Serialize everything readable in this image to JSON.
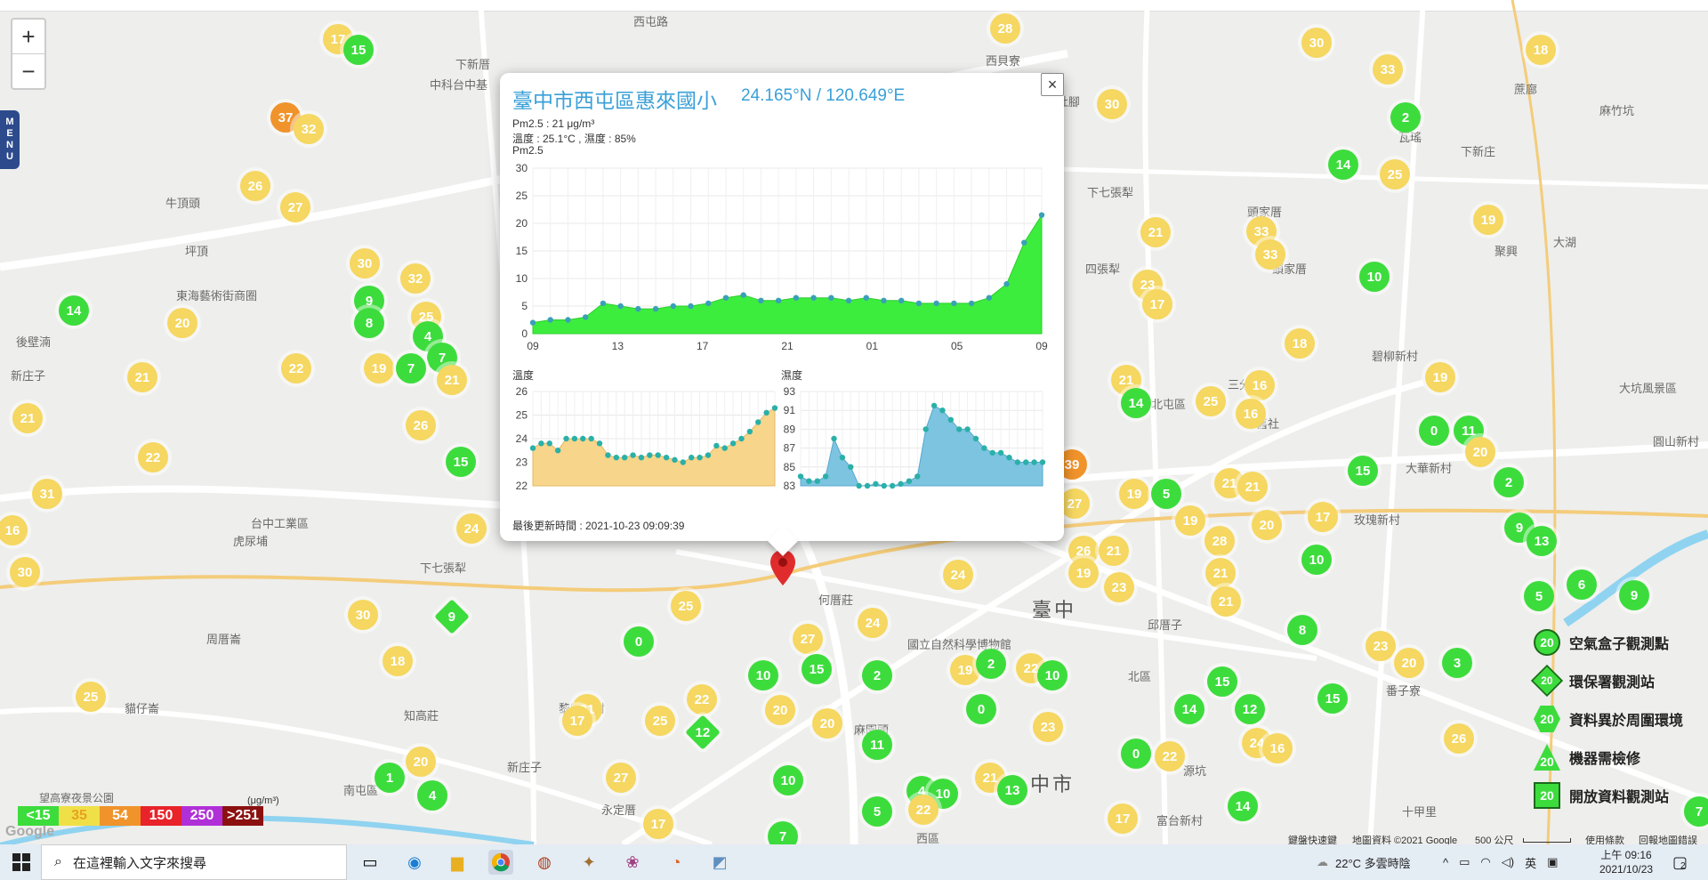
{
  "map": {
    "menu_label": [
      "M",
      "E",
      "N",
      "U"
    ],
    "zoom_in": "+",
    "zoom_out": "−",
    "places": [
      {
        "t": "下新厝",
        "x": 512,
        "y": 62
      },
      {
        "t": "中科台中基",
        "x": 483,
        "y": 85
      },
      {
        "t": "西屯路",
        "x": 712,
        "y": 14
      },
      {
        "t": "牛頂頭",
        "x": 186,
        "y": 218
      },
      {
        "t": "坪頂",
        "x": 208,
        "y": 272
      },
      {
        "t": "東海藝術街商圈",
        "x": 198,
        "y": 322
      },
      {
        "t": "後壁湳",
        "x": 18,
        "y": 374
      },
      {
        "t": "新庄子",
        "x": 12,
        "y": 412
      },
      {
        "t": "台中工業區",
        "x": 282,
        "y": 578
      },
      {
        "t": "虎尿埔",
        "x": 262,
        "y": 598
      },
      {
        "t": "下七張犁",
        "x": 472,
        "y": 628
      },
      {
        "t": "周厝崙",
        "x": 232,
        "y": 708
      },
      {
        "t": "貓仔崙",
        "x": 140,
        "y": 786
      },
      {
        "t": "知高莊",
        "x": 454,
        "y": 794
      },
      {
        "t": "南屯區",
        "x": 386,
        "y": 878
      },
      {
        "t": "黎明新村",
        "x": 628,
        "y": 786
      },
      {
        "t": "新庄子",
        "x": 570,
        "y": 852
      },
      {
        "t": "永定厝",
        "x": 676,
        "y": 900
      },
      {
        "t": "何厝莊",
        "x": 920,
        "y": 664
      },
      {
        "t": "國立自然科學博物館",
        "x": 1020,
        "y": 714
      },
      {
        "t": "麻園頭",
        "x": 960,
        "y": 810
      },
      {
        "t": "西區",
        "x": 1030,
        "y": 932
      },
      {
        "t": "邱厝子",
        "x": 1290,
        "y": 692
      },
      {
        "t": "北區",
        "x": 1268,
        "y": 750
      },
      {
        "t": "三分埔",
        "x": 1380,
        "y": 422
      },
      {
        "t": "北屯區",
        "x": 1294,
        "y": 444
      },
      {
        "t": "四張犁",
        "x": 1220,
        "y": 292
      },
      {
        "t": "頭家厝",
        "x": 1402,
        "y": 228
      },
      {
        "t": "頭家厝",
        "x": 1430,
        "y": 292
      },
      {
        "t": "下七張犁",
        "x": 1222,
        "y": 206
      },
      {
        "t": "社腳",
        "x": 1188,
        "y": 104
      },
      {
        "t": "西貝寮",
        "x": 1108,
        "y": 58
      },
      {
        "t": "瓦瑤",
        "x": 1572,
        "y": 144
      },
      {
        "t": "下新庄",
        "x": 1642,
        "y": 160
      },
      {
        "t": "大坑風景區",
        "x": 1820,
        "y": 426
      },
      {
        "t": "大華新村",
        "x": 1580,
        "y": 516
      },
      {
        "t": "玫瑰新村",
        "x": 1522,
        "y": 574
      },
      {
        "t": "大湖",
        "x": 1746,
        "y": 262
      },
      {
        "t": "聚興",
        "x": 1680,
        "y": 272
      },
      {
        "t": "麻竹坑",
        "x": 1798,
        "y": 114
      },
      {
        "t": "蔗廍",
        "x": 1702,
        "y": 90
      },
      {
        "t": "圓山新村",
        "x": 1858,
        "y": 486
      },
      {
        "t": "番子寮",
        "x": 1558,
        "y": 766
      },
      {
        "t": "十甲里",
        "x": 1576,
        "y": 902
      },
      {
        "t": "源坑",
        "x": 1330,
        "y": 856
      },
      {
        "t": "富台新村",
        "x": 1300,
        "y": 912
      },
      {
        "t": "碧柳新村",
        "x": 1542,
        "y": 390
      },
      {
        "t": "舊社",
        "x": 1412,
        "y": 466
      }
    ],
    "big_places": [
      {
        "t": "臺中",
        "x": 1160,
        "y": 668
      },
      {
        "t": "中市",
        "x": 1158,
        "y": 864
      }
    ],
    "markers": [
      {
        "v": "17",
        "c": "y",
        "x": 380,
        "y": 44
      },
      {
        "v": "15",
        "c": "g",
        "x": 403,
        "y": 56
      },
      {
        "v": "28",
        "c": "y",
        "x": 1130,
        "y": 32
      },
      {
        "v": "30",
        "c": "y",
        "x": 1480,
        "y": 48
      },
      {
        "v": "18",
        "c": "y",
        "x": 1732,
        "y": 56
      },
      {
        "v": "33",
        "c": "y",
        "x": 1560,
        "y": 78
      },
      {
        "v": "30",
        "c": "y",
        "x": 1250,
        "y": 117
      },
      {
        "v": "2",
        "c": "g",
        "x": 1580,
        "y": 132
      },
      {
        "v": "37",
        "c": "o",
        "x": 321,
        "y": 132
      },
      {
        "v": "32",
        "c": "y",
        "x": 347,
        "y": 145
      },
      {
        "v": "14",
        "c": "g",
        "x": 1510,
        "y": 185
      },
      {
        "v": "25",
        "c": "y",
        "x": 1568,
        "y": 196
      },
      {
        "v": "26",
        "c": "y",
        "x": 287,
        "y": 209
      },
      {
        "v": "27",
        "c": "y",
        "x": 332,
        "y": 233
      },
      {
        "v": "19",
        "c": "y",
        "x": 1673,
        "y": 247
      },
      {
        "v": "33",
        "c": "y",
        "x": 1418,
        "y": 260
      },
      {
        "v": "21",
        "c": "y",
        "x": 1299,
        "y": 261
      },
      {
        "v": "33",
        "c": "y",
        "x": 1428,
        "y": 286
      },
      {
        "v": "30",
        "c": "y",
        "x": 410,
        "y": 296
      },
      {
        "v": "32",
        "c": "y",
        "x": 467,
        "y": 313
      },
      {
        "v": "10",
        "c": "g",
        "x": 1545,
        "y": 311
      },
      {
        "v": "9",
        "c": "g",
        "x": 415,
        "y": 338
      },
      {
        "v": "23",
        "c": "y",
        "x": 1290,
        "y": 320
      },
      {
        "v": "17",
        "c": "y",
        "x": 1301,
        "y": 342
      },
      {
        "v": "14",
        "c": "g",
        "x": 83,
        "y": 349
      },
      {
        "v": "20",
        "c": "y",
        "x": 205,
        "y": 363
      },
      {
        "v": "8",
        "c": "g",
        "x": 415,
        "y": 363
      },
      {
        "v": "25",
        "c": "y",
        "x": 479,
        "y": 356
      },
      {
        "v": "4",
        "c": "g",
        "x": 481,
        "y": 378
      },
      {
        "v": "18",
        "c": "y",
        "x": 1461,
        "y": 386
      },
      {
        "v": "7",
        "c": "g",
        "x": 497,
        "y": 402
      },
      {
        "v": "22",
        "c": "y",
        "x": 333,
        "y": 414
      },
      {
        "v": "19",
        "c": "y",
        "x": 426,
        "y": 414
      },
      {
        "v": "7",
        "c": "g",
        "x": 462,
        "y": 414
      },
      {
        "v": "19",
        "c": "y",
        "x": 1619,
        "y": 424
      },
      {
        "v": "21",
        "c": "y",
        "x": 160,
        "y": 424
      },
      {
        "v": "21",
        "c": "y",
        "x": 508,
        "y": 427
      },
      {
        "v": "21",
        "c": "y",
        "x": 1266,
        "y": 427
      },
      {
        "v": "16",
        "c": "y",
        "x": 1416,
        "y": 433
      },
      {
        "v": "14",
        "c": "g",
        "x": 1277,
        "y": 453
      },
      {
        "v": "25",
        "c": "y",
        "x": 1361,
        "y": 451
      },
      {
        "v": "16",
        "c": "y",
        "x": 1406,
        "y": 465
      },
      {
        "v": "21",
        "c": "y",
        "x": 31,
        "y": 470
      },
      {
        "v": "26",
        "c": "y",
        "x": 473,
        "y": 478
      },
      {
        "v": "0",
        "c": "g",
        "x": 1612,
        "y": 484
      },
      {
        "v": "11",
        "c": "g",
        "x": 1651,
        "y": 484
      },
      {
        "v": "20",
        "c": "y",
        "x": 1664,
        "y": 508
      },
      {
        "v": "22",
        "c": "y",
        "x": 172,
        "y": 514
      },
      {
        "v": "15",
        "c": "g",
        "x": 518,
        "y": 519
      },
      {
        "v": "15",
        "c": "g",
        "x": 1532,
        "y": 529
      },
      {
        "v": "21",
        "c": "y",
        "x": 1382,
        "y": 543
      },
      {
        "v": "21",
        "c": "y",
        "x": 1408,
        "y": 547
      },
      {
        "v": "2",
        "c": "g",
        "x": 1696,
        "y": 542
      },
      {
        "v": "31",
        "c": "y",
        "x": 53,
        "y": 555
      },
      {
        "v": "19",
        "c": "y",
        "x": 1275,
        "y": 555
      },
      {
        "v": "5",
        "c": "g",
        "x": 1311,
        "y": 555
      },
      {
        "v": "27",
        "c": "y",
        "x": 1208,
        "y": 566
      },
      {
        "v": "17",
        "c": "y",
        "x": 1487,
        "y": 581
      },
      {
        "v": "19",
        "c": "y",
        "x": 1338,
        "y": 585
      },
      {
        "v": "20",
        "c": "y",
        "x": 1424,
        "y": 590
      },
      {
        "v": "9",
        "c": "g",
        "x": 1708,
        "y": 593
      },
      {
        "v": "16",
        "c": "y",
        "x": 14,
        "y": 596
      },
      {
        "v": "24",
        "c": "y",
        "x": 530,
        "y": 594
      },
      {
        "v": "28",
        "c": "y",
        "x": 1371,
        "y": 608
      },
      {
        "v": "13",
        "c": "g",
        "x": 1733,
        "y": 608
      },
      {
        "v": "26",
        "c": "y",
        "x": 1218,
        "y": 619
      },
      {
        "v": "21",
        "c": "y",
        "x": 1252,
        "y": 619
      },
      {
        "v": "10",
        "c": "g",
        "x": 1480,
        "y": 629
      },
      {
        "v": "30",
        "c": "y",
        "x": 28,
        "y": 643
      },
      {
        "v": "21",
        "c": "y",
        "x": 1372,
        "y": 644
      },
      {
        "v": "24",
        "c": "y",
        "x": 1077,
        "y": 646
      },
      {
        "v": "19",
        "c": "y",
        "x": 1218,
        "y": 644
      },
      {
        "v": "23",
        "c": "y",
        "x": 1258,
        "y": 660
      },
      {
        "v": "6",
        "c": "g",
        "x": 1778,
        "y": 657
      },
      {
        "v": "21",
        "c": "y",
        "x": 1378,
        "y": 676
      },
      {
        "v": "5",
        "c": "g",
        "x": 1730,
        "y": 670
      },
      {
        "v": "9",
        "c": "g",
        "x": 1837,
        "y": 669
      },
      {
        "v": "25",
        "c": "y",
        "x": 771,
        "y": 681
      },
      {
        "v": "30",
        "c": "y",
        "x": 408,
        "y": 691
      },
      {
        "v": "8",
        "c": "g",
        "x": 1464,
        "y": 708
      },
      {
        "v": "0",
        "c": "g",
        "x": 718,
        "y": 721
      },
      {
        "v": "24",
        "c": "y",
        "x": 981,
        "y": 700
      },
      {
        "v": "27",
        "c": "y",
        "x": 908,
        "y": 718
      },
      {
        "v": "23",
        "c": "y",
        "x": 1552,
        "y": 726
      },
      {
        "v": "20",
        "c": "y",
        "x": 1584,
        "y": 745
      },
      {
        "v": "3",
        "c": "g",
        "x": 1638,
        "y": 745
      },
      {
        "v": "18",
        "c": "y",
        "x": 447,
        "y": 743
      },
      {
        "v": "10",
        "c": "g",
        "x": 858,
        "y": 759
      },
      {
        "v": "15",
        "c": "g",
        "x": 918,
        "y": 752
      },
      {
        "v": "2",
        "c": "g",
        "x": 986,
        "y": 759
      },
      {
        "v": "19",
        "c": "y",
        "x": 1085,
        "y": 753
      },
      {
        "v": "2",
        "c": "g",
        "x": 1114,
        "y": 746
      },
      {
        "v": "22",
        "c": "y",
        "x": 1159,
        "y": 751
      },
      {
        "v": "10",
        "c": "g",
        "x": 1183,
        "y": 759
      },
      {
        "v": "15",
        "c": "g",
        "x": 1374,
        "y": 766
      },
      {
        "v": "25",
        "c": "y",
        "x": 102,
        "y": 783
      },
      {
        "v": "22",
        "c": "y",
        "x": 789,
        "y": 786
      },
      {
        "v": "15",
        "c": "g",
        "x": 1498,
        "y": 785
      },
      {
        "v": "20",
        "c": "y",
        "x": 877,
        "y": 798
      },
      {
        "v": "0",
        "c": "g",
        "x": 1103,
        "y": 797
      },
      {
        "v": "14",
        "c": "g",
        "x": 1337,
        "y": 797
      },
      {
        "v": "12",
        "c": "g",
        "x": 1405,
        "y": 797
      },
      {
        "v": "31",
        "c": "y",
        "x": 660,
        "y": 797
      },
      {
        "v": "17",
        "c": "y",
        "x": 649,
        "y": 810
      },
      {
        "v": "25",
        "c": "y",
        "x": 742,
        "y": 810
      },
      {
        "v": "20",
        "c": "y",
        "x": 930,
        "y": 813
      },
      {
        "v": "23",
        "c": "y",
        "x": 1178,
        "y": 817
      },
      {
        "v": "26",
        "c": "y",
        "x": 1640,
        "y": 830
      },
      {
        "v": "24",
        "c": "y",
        "x": 1413,
        "y": 835
      },
      {
        "v": "16",
        "c": "y",
        "x": 1436,
        "y": 841
      },
      {
        "v": "11",
        "c": "g",
        "x": 986,
        "y": 837
      },
      {
        "v": "0",
        "c": "g",
        "x": 1277,
        "y": 847
      },
      {
        "v": "22",
        "c": "y",
        "x": 1315,
        "y": 850
      },
      {
        "v": "20",
        "c": "y",
        "x": 473,
        "y": 856
      },
      {
        "v": "1",
        "c": "g",
        "x": 438,
        "y": 874
      },
      {
        "v": "27",
        "c": "y",
        "x": 698,
        "y": 874
      },
      {
        "v": "10",
        "c": "g",
        "x": 886,
        "y": 877
      },
      {
        "v": "21",
        "c": "y",
        "x": 1113,
        "y": 874
      },
      {
        "v": "4",
        "c": "g",
        "x": 1036,
        "y": 889
      },
      {
        "v": "10",
        "c": "g",
        "x": 1060,
        "y": 892
      },
      {
        "v": "13",
        "c": "g",
        "x": 1138,
        "y": 888
      },
      {
        "v": "4",
        "c": "g",
        "x": 486,
        "y": 894
      },
      {
        "v": "22",
        "c": "y",
        "x": 1038,
        "y": 910
      },
      {
        "v": "14",
        "c": "g",
        "x": 1397,
        "y": 906
      },
      {
        "v": "5",
        "c": "g",
        "x": 986,
        "y": 912
      },
      {
        "v": "17",
        "c": "y",
        "x": 1262,
        "y": 920
      },
      {
        "v": "17",
        "c": "y",
        "x": 740,
        "y": 926
      },
      {
        "v": "7",
        "c": "g",
        "x": 1910,
        "y": 912
      },
      {
        "v": "7",
        "c": "g",
        "x": 880,
        "y": 940
      }
    ],
    "diamonds": [
      {
        "v": "9",
        "c": "g",
        "x": 508,
        "y": 693
      },
      {
        "v": "12",
        "c": "g",
        "x": 790,
        "y": 823
      }
    ],
    "orange_right": {
      "v": "39",
      "x": 1205,
      "y": 522
    },
    "legend": [
      {
        "icon": "circle",
        "v": "20",
        "label": "空氣盒子觀測點"
      },
      {
        "icon": "diamond",
        "v": "20",
        "label": "環保署觀測站"
      },
      {
        "icon": "hexagon",
        "v": "20",
        "label": "資料異於周圍環境"
      },
      {
        "icon": "triangle",
        "v": "20",
        "label": "機器需檢修"
      },
      {
        "icon": "square",
        "v": "20",
        "label": "開放資料觀測站"
      }
    ],
    "pm_scale": [
      {
        "label": "<15",
        "color": "#3ddc3d"
      },
      {
        "label": "35",
        "color": "#f0e048"
      },
      {
        "label": "54",
        "color": "#f0932b"
      },
      {
        "label": "150",
        "color": "#e8232a"
      },
      {
        "label": "250",
        "color": "#b030d8"
      },
      {
        "label": ">251",
        "color": "#8b1010"
      }
    ],
    "pm_unit": "(μg/m³)",
    "bottom_place": "望高寮夜景公園",
    "google": "Google",
    "attribution": [
      "鍵盤快速鍵",
      "地圖資料 ©2021 Google",
      "500 公尺",
      "使用條款",
      "回報地圖錯誤"
    ]
  },
  "popup": {
    "title": "臺中市西屯區惠來國小",
    "coords": "24.165°N / 120.649°E",
    "pm_line": "Pm2.5 : 21 μg/m³",
    "temp_line": "溫度 : 25.1°C , 濕度 : 85%",
    "chart_label": "Pm2.5",
    "temp_label": "溫度",
    "hum_label": "濕度",
    "updated": "最後更新時間 : 2021-10-23 09:09:39",
    "close": "×"
  },
  "chart_data": [
    {
      "type": "area",
      "title": "Pm2.5",
      "x_ticks": [
        "09",
        "13",
        "17",
        "21",
        "01",
        "05",
        "09"
      ],
      "ylim": [
        0,
        30
      ],
      "y_ticks": [
        0,
        5,
        10,
        15,
        20,
        25,
        30
      ],
      "values": [
        2,
        2.5,
        2.5,
        3,
        5.5,
        5,
        4.5,
        4.5,
        5,
        5,
        5.5,
        6.5,
        7,
        6,
        6,
        6.5,
        6.5,
        6.5,
        6,
        6.5,
        6,
        6,
        5.5,
        5.5,
        5.5,
        5.5,
        6.5,
        9,
        16.5,
        21.5
      ]
    },
    {
      "type": "area",
      "title": "溫度",
      "ylim": [
        22,
        26
      ],
      "y_ticks": [
        22,
        23,
        24,
        25,
        26
      ],
      "values": [
        23.6,
        23.8,
        23.8,
        23.5,
        24.0,
        24.0,
        24.0,
        24.0,
        23.8,
        23.3,
        23.2,
        23.2,
        23.3,
        23.2,
        23.3,
        23.3,
        23.2,
        23.1,
        23.0,
        23.2,
        23.2,
        23.3,
        23.7,
        23.6,
        23.8,
        24.0,
        24.3,
        24.7,
        25.1,
        25.3
      ]
    },
    {
      "type": "area",
      "title": "濕度",
      "ylim": [
        83,
        93
      ],
      "y_ticks": [
        83,
        85,
        87,
        89,
        91,
        93
      ],
      "values": [
        84,
        83.5,
        83.5,
        84,
        88,
        86,
        85,
        83,
        83,
        83.2,
        83,
        83,
        83.2,
        83.5,
        84,
        89,
        91.5,
        91,
        90,
        89,
        89,
        88,
        87,
        86.5,
        86.5,
        86,
        85.5,
        85.5,
        85.5,
        85.5
      ]
    }
  ],
  "taskbar": {
    "search_placeholder": "在這裡輸入文字來搜尋",
    "weather": "22°C 多雲時陰",
    "ime": "英",
    "time": "上午 09:16",
    "date": "2021/10/23",
    "notif": "2"
  }
}
